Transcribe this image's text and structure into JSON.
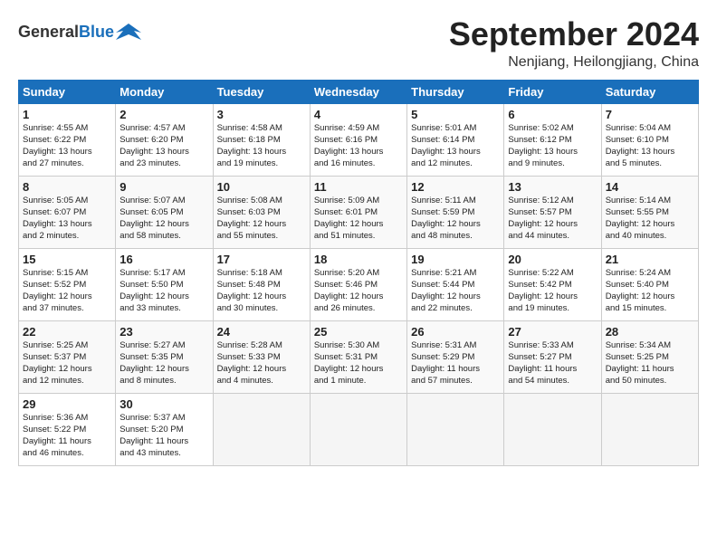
{
  "header": {
    "logo_general": "General",
    "logo_blue": "Blue",
    "month_title": "September 2024",
    "location": "Nenjiang, Heilongjiang, China"
  },
  "weekdays": [
    "Sunday",
    "Monday",
    "Tuesday",
    "Wednesday",
    "Thursday",
    "Friday",
    "Saturday"
  ],
  "weeks": [
    [
      {
        "day": "1",
        "lines": [
          "Sunrise: 4:55 AM",
          "Sunset: 6:22 PM",
          "Daylight: 13 hours",
          "and 27 minutes."
        ]
      },
      {
        "day": "2",
        "lines": [
          "Sunrise: 4:57 AM",
          "Sunset: 6:20 PM",
          "Daylight: 13 hours",
          "and 23 minutes."
        ]
      },
      {
        "day": "3",
        "lines": [
          "Sunrise: 4:58 AM",
          "Sunset: 6:18 PM",
          "Daylight: 13 hours",
          "and 19 minutes."
        ]
      },
      {
        "day": "4",
        "lines": [
          "Sunrise: 4:59 AM",
          "Sunset: 6:16 PM",
          "Daylight: 13 hours",
          "and 16 minutes."
        ]
      },
      {
        "day": "5",
        "lines": [
          "Sunrise: 5:01 AM",
          "Sunset: 6:14 PM",
          "Daylight: 13 hours",
          "and 12 minutes."
        ]
      },
      {
        "day": "6",
        "lines": [
          "Sunrise: 5:02 AM",
          "Sunset: 6:12 PM",
          "Daylight: 13 hours",
          "and 9 minutes."
        ]
      },
      {
        "day": "7",
        "lines": [
          "Sunrise: 5:04 AM",
          "Sunset: 6:10 PM",
          "Daylight: 13 hours",
          "and 5 minutes."
        ]
      }
    ],
    [
      {
        "day": "8",
        "lines": [
          "Sunrise: 5:05 AM",
          "Sunset: 6:07 PM",
          "Daylight: 13 hours",
          "and 2 minutes."
        ]
      },
      {
        "day": "9",
        "lines": [
          "Sunrise: 5:07 AM",
          "Sunset: 6:05 PM",
          "Daylight: 12 hours",
          "and 58 minutes."
        ]
      },
      {
        "day": "10",
        "lines": [
          "Sunrise: 5:08 AM",
          "Sunset: 6:03 PM",
          "Daylight: 12 hours",
          "and 55 minutes."
        ]
      },
      {
        "day": "11",
        "lines": [
          "Sunrise: 5:09 AM",
          "Sunset: 6:01 PM",
          "Daylight: 12 hours",
          "and 51 minutes."
        ]
      },
      {
        "day": "12",
        "lines": [
          "Sunrise: 5:11 AM",
          "Sunset: 5:59 PM",
          "Daylight: 12 hours",
          "and 48 minutes."
        ]
      },
      {
        "day": "13",
        "lines": [
          "Sunrise: 5:12 AM",
          "Sunset: 5:57 PM",
          "Daylight: 12 hours",
          "and 44 minutes."
        ]
      },
      {
        "day": "14",
        "lines": [
          "Sunrise: 5:14 AM",
          "Sunset: 5:55 PM",
          "Daylight: 12 hours",
          "and 40 minutes."
        ]
      }
    ],
    [
      {
        "day": "15",
        "lines": [
          "Sunrise: 5:15 AM",
          "Sunset: 5:52 PM",
          "Daylight: 12 hours",
          "and 37 minutes."
        ]
      },
      {
        "day": "16",
        "lines": [
          "Sunrise: 5:17 AM",
          "Sunset: 5:50 PM",
          "Daylight: 12 hours",
          "and 33 minutes."
        ]
      },
      {
        "day": "17",
        "lines": [
          "Sunrise: 5:18 AM",
          "Sunset: 5:48 PM",
          "Daylight: 12 hours",
          "and 30 minutes."
        ]
      },
      {
        "day": "18",
        "lines": [
          "Sunrise: 5:20 AM",
          "Sunset: 5:46 PM",
          "Daylight: 12 hours",
          "and 26 minutes."
        ]
      },
      {
        "day": "19",
        "lines": [
          "Sunrise: 5:21 AM",
          "Sunset: 5:44 PM",
          "Daylight: 12 hours",
          "and 22 minutes."
        ]
      },
      {
        "day": "20",
        "lines": [
          "Sunrise: 5:22 AM",
          "Sunset: 5:42 PM",
          "Daylight: 12 hours",
          "and 19 minutes."
        ]
      },
      {
        "day": "21",
        "lines": [
          "Sunrise: 5:24 AM",
          "Sunset: 5:40 PM",
          "Daylight: 12 hours",
          "and 15 minutes."
        ]
      }
    ],
    [
      {
        "day": "22",
        "lines": [
          "Sunrise: 5:25 AM",
          "Sunset: 5:37 PM",
          "Daylight: 12 hours",
          "and 12 minutes."
        ]
      },
      {
        "day": "23",
        "lines": [
          "Sunrise: 5:27 AM",
          "Sunset: 5:35 PM",
          "Daylight: 12 hours",
          "and 8 minutes."
        ]
      },
      {
        "day": "24",
        "lines": [
          "Sunrise: 5:28 AM",
          "Sunset: 5:33 PM",
          "Daylight: 12 hours",
          "and 4 minutes."
        ]
      },
      {
        "day": "25",
        "lines": [
          "Sunrise: 5:30 AM",
          "Sunset: 5:31 PM",
          "Daylight: 12 hours",
          "and 1 minute."
        ]
      },
      {
        "day": "26",
        "lines": [
          "Sunrise: 5:31 AM",
          "Sunset: 5:29 PM",
          "Daylight: 11 hours",
          "and 57 minutes."
        ]
      },
      {
        "day": "27",
        "lines": [
          "Sunrise: 5:33 AM",
          "Sunset: 5:27 PM",
          "Daylight: 11 hours",
          "and 54 minutes."
        ]
      },
      {
        "day": "28",
        "lines": [
          "Sunrise: 5:34 AM",
          "Sunset: 5:25 PM",
          "Daylight: 11 hours",
          "and 50 minutes."
        ]
      }
    ],
    [
      {
        "day": "29",
        "lines": [
          "Sunrise: 5:36 AM",
          "Sunset: 5:22 PM",
          "Daylight: 11 hours",
          "and 46 minutes."
        ]
      },
      {
        "day": "30",
        "lines": [
          "Sunrise: 5:37 AM",
          "Sunset: 5:20 PM",
          "Daylight: 11 hours",
          "and 43 minutes."
        ]
      },
      {
        "day": "",
        "lines": []
      },
      {
        "day": "",
        "lines": []
      },
      {
        "day": "",
        "lines": []
      },
      {
        "day": "",
        "lines": []
      },
      {
        "day": "",
        "lines": []
      }
    ]
  ]
}
